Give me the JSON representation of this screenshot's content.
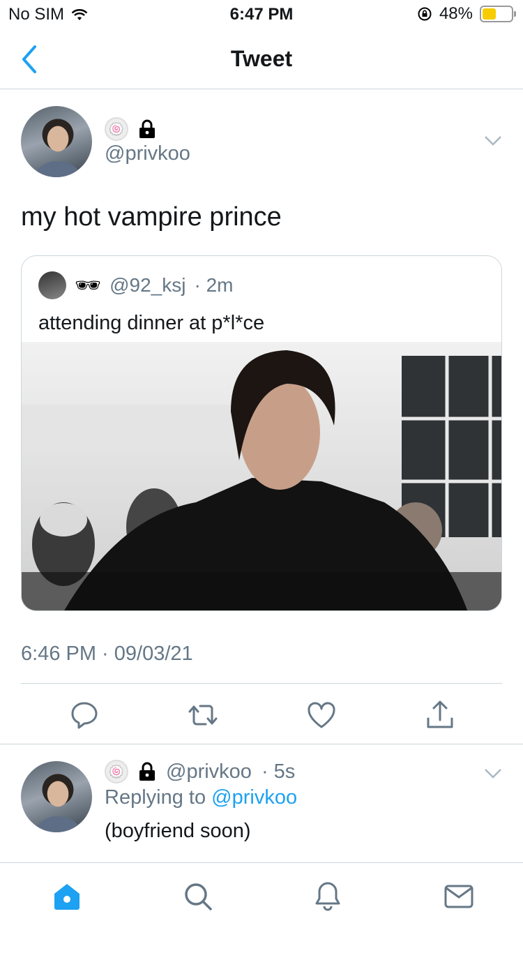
{
  "status": {
    "carrier": "No SIM",
    "time": "6:47 PM",
    "battery": "48%",
    "battery_level": 0.48
  },
  "nav": {
    "title": "Tweet"
  },
  "tweet": {
    "badge_emoji": "🍥",
    "handle": "@privkoo",
    "text": "my hot vampire prince",
    "timestamp": "6:46 PM · 09/03/21"
  },
  "quote": {
    "emoji": "🕶",
    "handle": "@92_ksj",
    "age": "· 2m",
    "text": "attending dinner at p*l*ce"
  },
  "reply": {
    "badge_emoji": "🍥",
    "handle": "@privkoo",
    "age": "· 5s",
    "replying_prefix": "Replying to",
    "replying_to": "@privkoo",
    "text": "(boyfriend soon)"
  },
  "colors": {
    "accent": "#1da1f2",
    "muted": "#657786",
    "border": "#ccd6dd"
  }
}
